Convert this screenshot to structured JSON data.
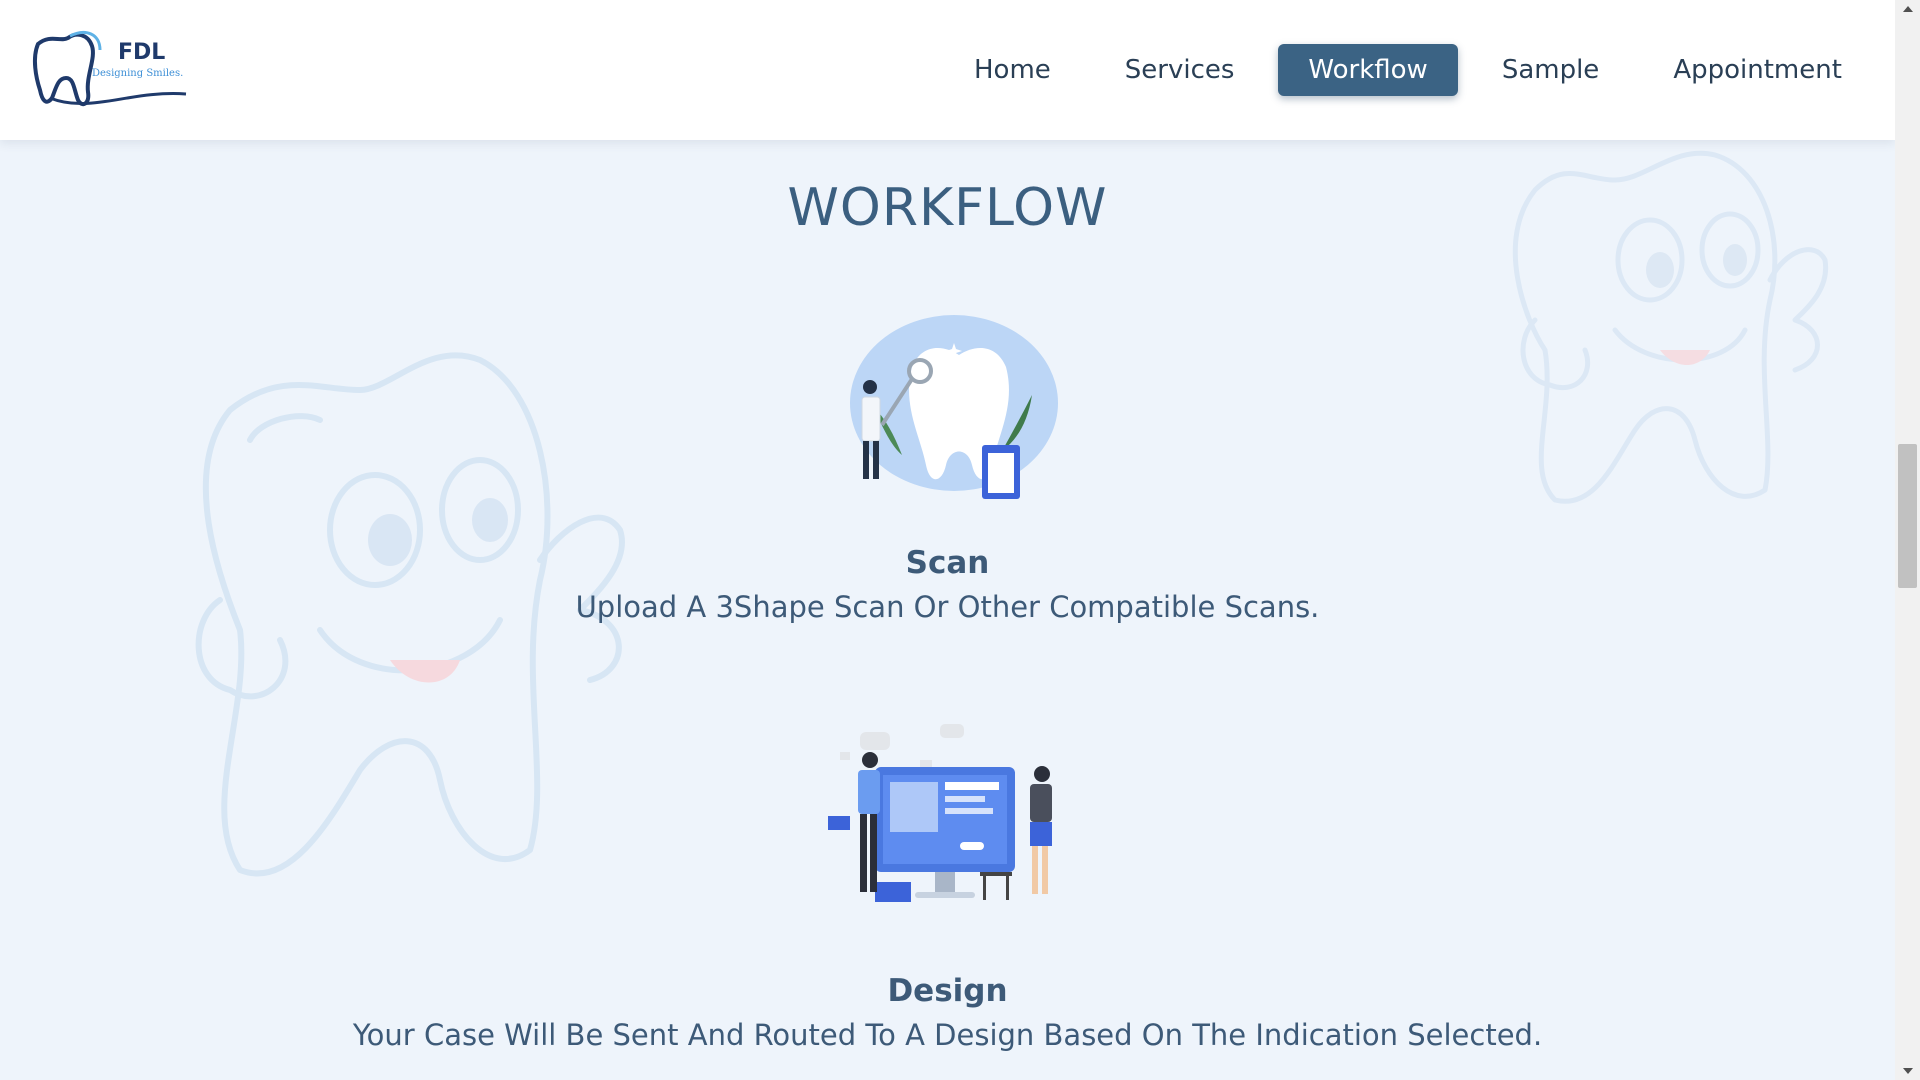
{
  "brand": {
    "name": "FDL",
    "tagline": "Designing Smiles."
  },
  "nav": {
    "items": [
      {
        "label": "Home",
        "active": false
      },
      {
        "label": "Services",
        "active": false
      },
      {
        "label": "Workflow",
        "active": true
      },
      {
        "label": "Sample",
        "active": false
      },
      {
        "label": "Appointment",
        "active": false
      }
    ]
  },
  "page": {
    "title": "WORKFLOW"
  },
  "steps": [
    {
      "title": "Scan",
      "description": "Upload A 3Shape Scan Or Other Compatible Scans.",
      "icon": "dentist-tooth-illustration"
    },
    {
      "title": "Design",
      "description": "Your Case Will Be Sent And Routed To A Design Based On The Indication Selected.",
      "icon": "design-team-illustration"
    }
  ],
  "colors": {
    "accent": "#3b6384",
    "background": "#eef4fb",
    "text": "#3d5a78"
  }
}
